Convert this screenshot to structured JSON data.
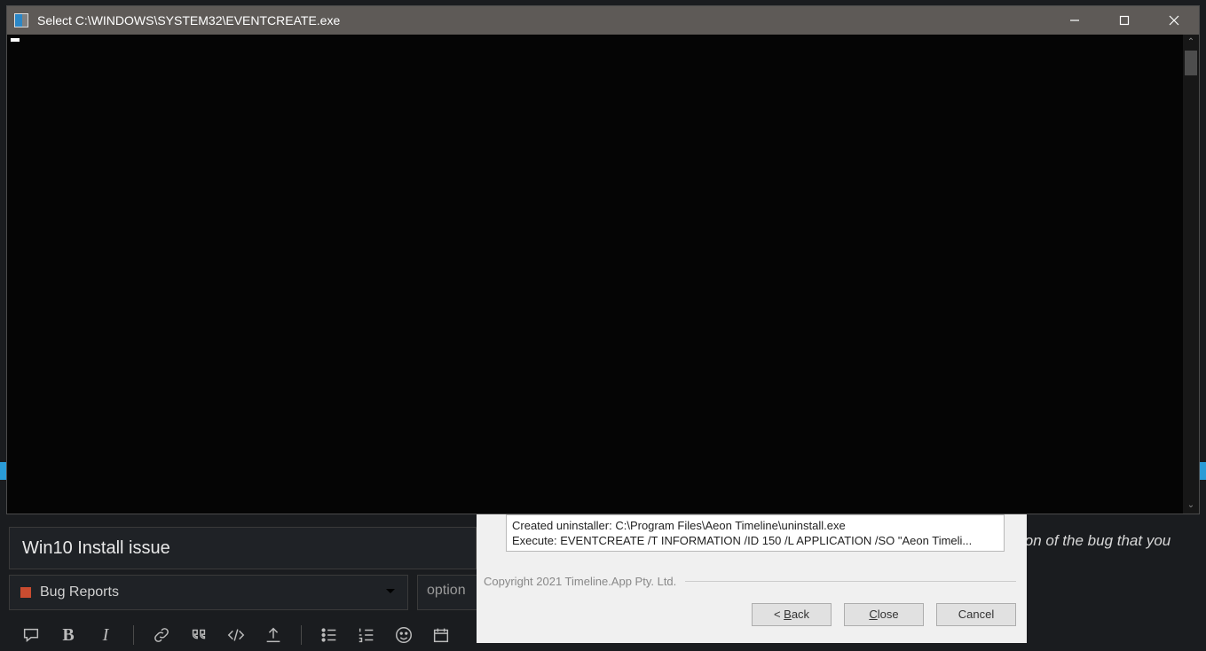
{
  "background": {
    "helper_text": "ion of the bug that you "
  },
  "console": {
    "title": "Select C:\\WINDOWS\\SYSTEM32\\EVENTCREATE.exe"
  },
  "installer": {
    "log_lines": [
      "Created uninstaller: C:\\Program Files\\Aeon Timeline\\uninstall.exe",
      "Execute: EVENTCREATE /T INFORMATION /ID 150 /L APPLICATION /SO \"Aeon Timeli..."
    ],
    "copyright": "Copyright 2021 Timeline.App Pty. Ltd.",
    "buttons": {
      "back_prefix": "< ",
      "back_u": "B",
      "back_rest": "ack",
      "close_u": "C",
      "close_rest": "lose",
      "cancel": "Cancel"
    }
  },
  "editor": {
    "title_value": "Win10 Install issue",
    "category": "Bug Reports",
    "tags_placeholder": "option",
    "toolbar_glyphs": {
      "bold": "B",
      "italic": "I"
    }
  }
}
